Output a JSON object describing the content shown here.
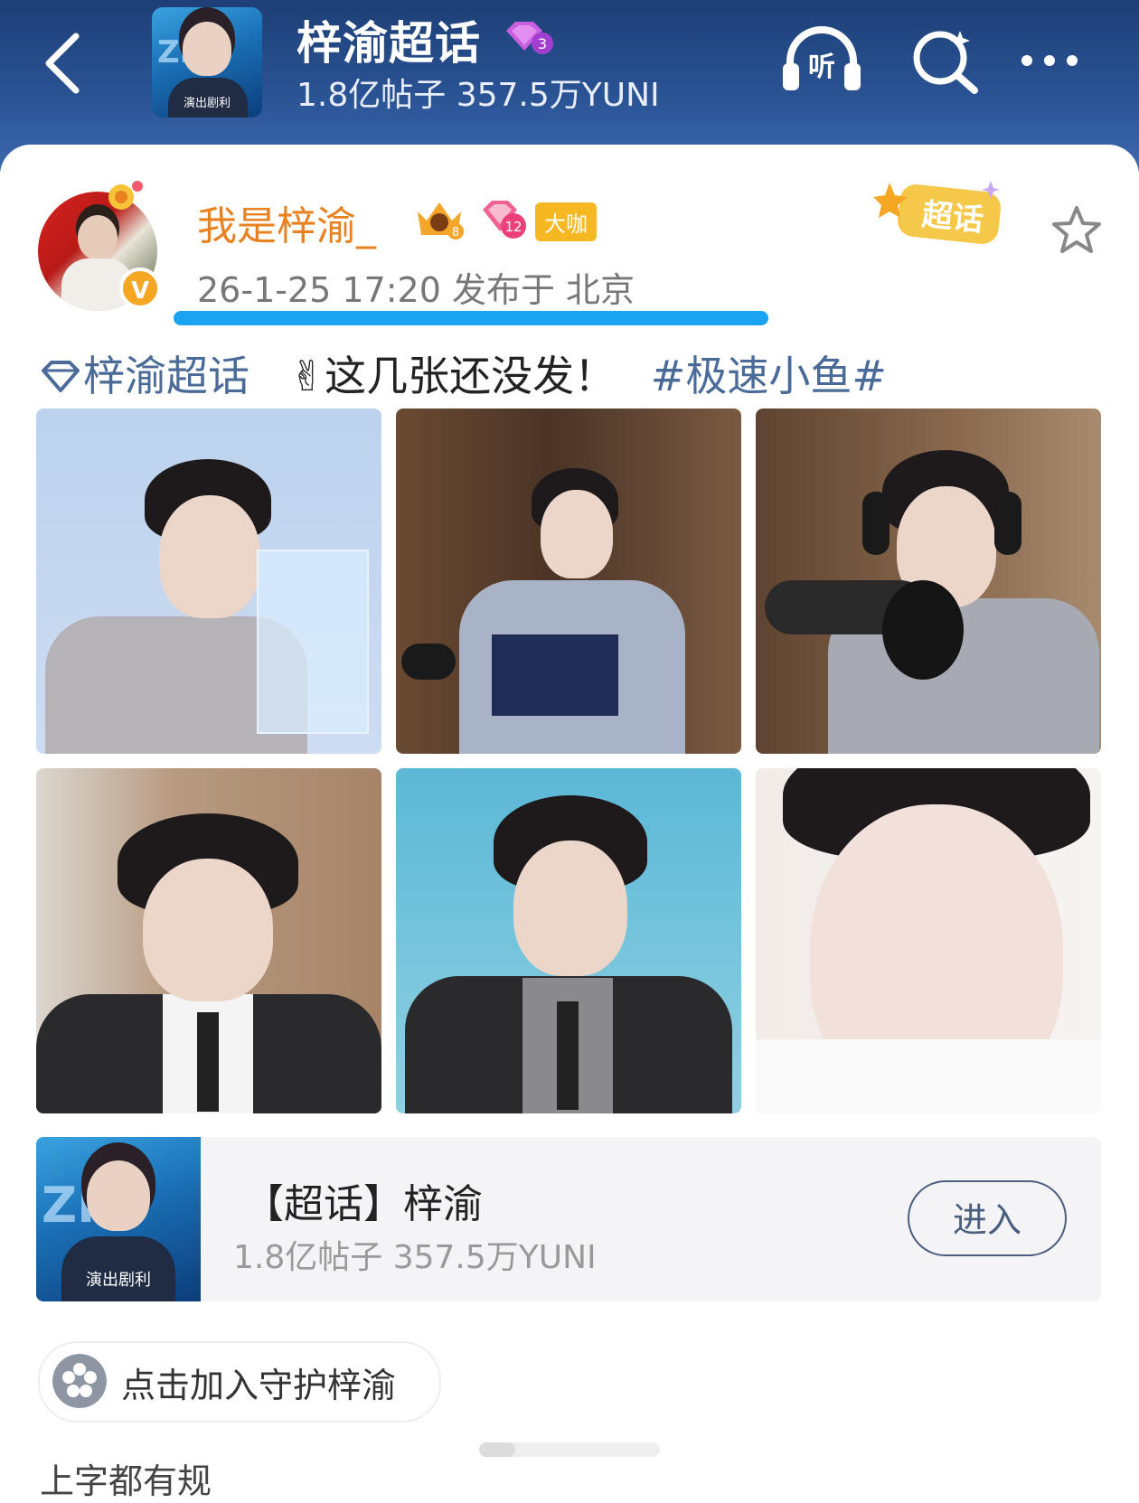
{
  "header": {
    "title": "梓渝超话",
    "stats": "1.8亿帖子 357.5万YUNI",
    "thumb_text": "演出剧利",
    "level": "3"
  },
  "post": {
    "username": "我是梓渝_",
    "badge_level": "8",
    "gem_level": "12",
    "tag": "大咖",
    "meta": "26-1-25 17:20  发布于 北京",
    "chaohua_label": "超话",
    "topic": "梓渝超话",
    "text": "✌这几张还没发！",
    "hashtag": "#极速小鱼#"
  },
  "supertopic_card": {
    "title": "【超话】梓渝",
    "stats": "1.8亿帖子 357.5万YUNI",
    "enter_label": "进入",
    "thumb_text": "演出剧利"
  },
  "guard": {
    "label": "点击加入守护梓渝"
  },
  "next_line": "上字都有规",
  "colors": {
    "accent": "#1aa3f0",
    "username": "#e8811f",
    "topic": "#4a6a97",
    "header": "#2a5394"
  }
}
